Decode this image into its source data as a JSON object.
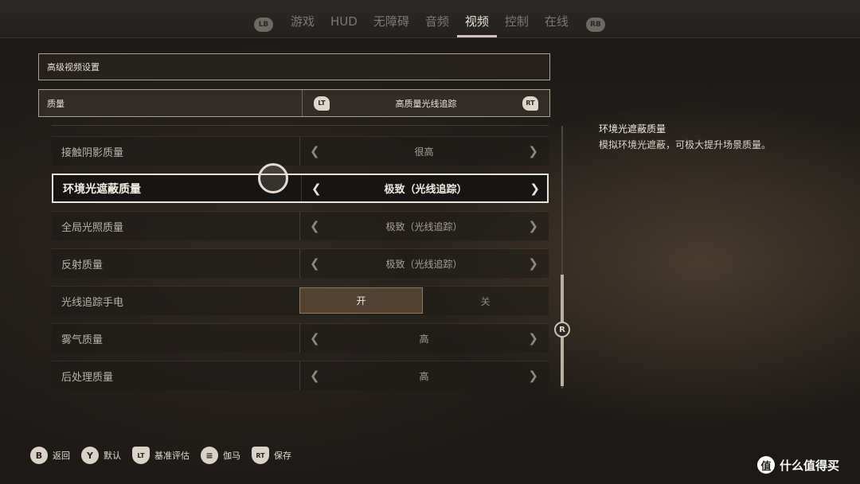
{
  "tabs": {
    "left_bumper": "LB",
    "right_bumper": "RB",
    "items": [
      "游戏",
      "HUD",
      "无障碍",
      "音频",
      "视频",
      "控制",
      "在线"
    ],
    "active": "视频"
  },
  "panel": {
    "title": "高级视频设置",
    "quality": {
      "label": "质量",
      "left_trigger": "LT",
      "right_trigger": "RT",
      "value": "高质量光线追踪"
    }
  },
  "settings": [
    {
      "label": "接触阴影质量",
      "value": "很高"
    },
    {
      "label": "环境光遮蔽质量",
      "value": "极致（光线追踪）",
      "selected": true
    },
    {
      "label": "全局光照质量",
      "value": "极致（光线追踪）"
    },
    {
      "label": "反射质量",
      "value": "极致（光线追踪）"
    },
    {
      "label": "光线追踪手电",
      "toggle": {
        "on": "开",
        "off": "关",
        "state": "on"
      }
    },
    {
      "label": "雾气质量",
      "value": "高"
    },
    {
      "label": "后处理质量",
      "value": "高"
    }
  ],
  "scroll": {
    "knob_label": "R"
  },
  "description": {
    "title": "环境光遮蔽质量",
    "text": "模拟环境光遮蔽，可极大提升场景质量。"
  },
  "hints": [
    {
      "icon": "B",
      "label": "返回",
      "icon_name": "b-button-icon"
    },
    {
      "icon": "Y",
      "label": "默认",
      "icon_name": "y-button-icon"
    },
    {
      "icon": "LT",
      "label": "基准评估",
      "icon_name": "lt-trigger-icon"
    },
    {
      "icon": "≡",
      "label": "伽马",
      "icon_name": "menu-button-icon"
    },
    {
      "icon": "RT",
      "label": "保存",
      "icon_name": "rt-trigger-icon"
    }
  ],
  "watermark": {
    "icon": "值",
    "label": "什么值得买"
  }
}
